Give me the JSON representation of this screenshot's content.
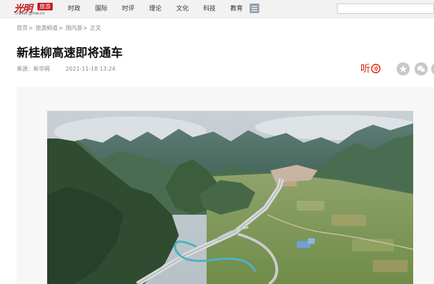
{
  "header": {
    "logo_script": "光明",
    "logo_badge": "旅游",
    "logo_url": "travel.gmw.cn",
    "nav": [
      "时政",
      "国际",
      "时评",
      "理论",
      "文化",
      "科技",
      "教育"
    ],
    "search": {
      "value": "",
      "placeholder": ""
    }
  },
  "breadcrumb": [
    "首页",
    "旅游频道",
    "国内游",
    "正文"
  ],
  "article": {
    "title": "新桂柳高速即将通车",
    "source": "来源：新华网",
    "date": "2021-11-18 13:24",
    "listen_label": "听"
  },
  "colors": {
    "brand_red": "#c8161d",
    "listen_red": "#d81e06",
    "share_gray": "#c9c9c9"
  },
  "icons": [
    "menu-icon",
    "listen-icon",
    "star-icon",
    "wechat-icon",
    "weibo-icon"
  ]
}
